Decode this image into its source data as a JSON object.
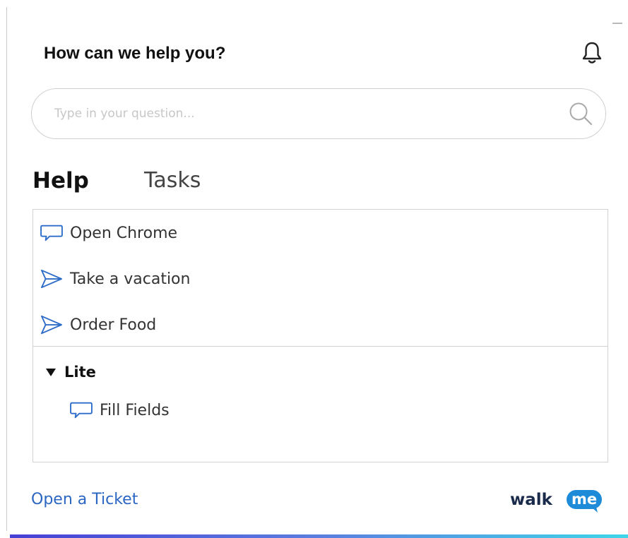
{
  "header": {
    "title": "How can we help you?"
  },
  "search": {
    "placeholder": "Type in your question..."
  },
  "tabs": [
    {
      "label": "Help",
      "active": true
    },
    {
      "label": "Tasks",
      "active": false
    }
  ],
  "items": [
    {
      "label": "Open Chrome",
      "icon": "speech-bubble-icon"
    },
    {
      "label": "Take a vacation",
      "icon": "paper-plane-icon"
    },
    {
      "label": "Order Food",
      "icon": "paper-plane-icon"
    }
  ],
  "group": {
    "label": "Lite",
    "expanded": true,
    "items": [
      {
        "label": "Fill Fields",
        "icon": "speech-bubble-icon"
      }
    ]
  },
  "footer": {
    "ticket_link": "Open a Ticket",
    "logo_text_left": "walk",
    "logo_text_right": "me"
  },
  "colors": {
    "accent_blue": "#2a66c2",
    "icon_blue": "#2d6cc9",
    "logo_blue": "#1e8bd8",
    "gradient_start": "#4740d4",
    "gradient_end": "#3fd6e8"
  }
}
